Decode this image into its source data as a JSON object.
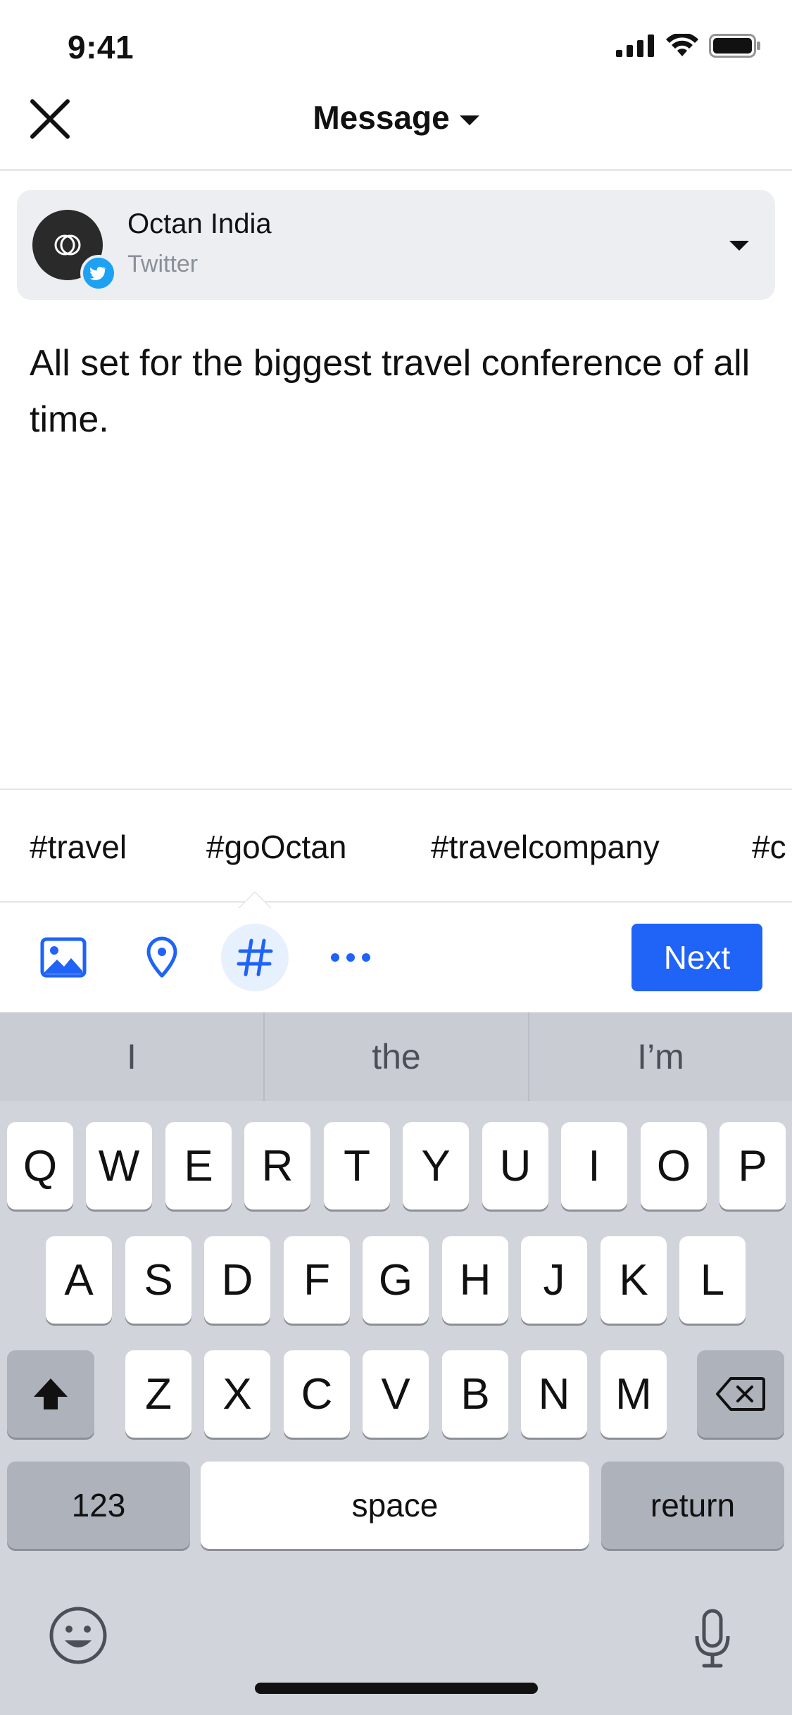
{
  "status_bar": {
    "time": "9:41"
  },
  "header": {
    "title": "Message"
  },
  "account": {
    "name": "Octan India",
    "platform": "Twitter"
  },
  "message": {
    "text": "All set for the biggest travel conference of all time."
  },
  "hashtags": [
    "#travel",
    "#goOctan",
    "#travelcompany",
    "#c"
  ],
  "toolbar": {
    "next_label": "Next"
  },
  "keyboard": {
    "suggestions": [
      "I",
      "the",
      "I’m"
    ],
    "row1": [
      "Q",
      "W",
      "E",
      "R",
      "T",
      "Y",
      "U",
      "I",
      "O",
      "P"
    ],
    "row2": [
      "A",
      "S",
      "D",
      "F",
      "G",
      "H",
      "J",
      "K",
      "L"
    ],
    "row3": [
      "Z",
      "X",
      "C",
      "V",
      "B",
      "N",
      "M"
    ],
    "numbers_label": "123",
    "space_label": "space",
    "return_label": "return"
  },
  "colors": {
    "accent": "#1f63f7",
    "twitter": "#1da1f2"
  }
}
